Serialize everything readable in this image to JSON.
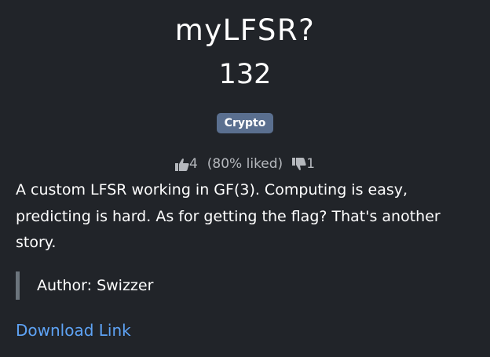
{
  "challenge": {
    "title": "myLFSR?",
    "points": "132",
    "category": "Crypto",
    "likes": "4",
    "liked_percent": "(80% liked)",
    "dislikes": "1",
    "description": "A custom LFSR working in GF(3). Computing is easy, predicting is hard. As for getting the flag? That's another story.",
    "author": "Author: Swizzer",
    "download_label": "Download Link"
  },
  "icons": {
    "like": "thumbs-up-icon",
    "dislike": "thumbs-down-icon"
  },
  "colors": {
    "background": "#212429",
    "badge": "#5a6f8f",
    "link": "#5ea3f5",
    "muted": "#b5b8bd"
  }
}
